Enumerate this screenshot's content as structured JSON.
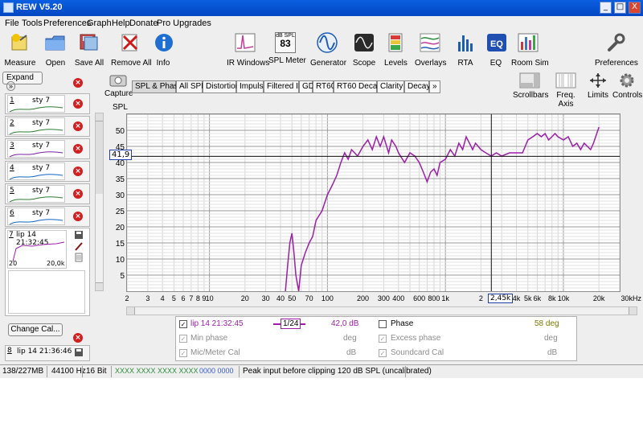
{
  "window": {
    "title": "REW V5.20"
  },
  "window_buttons": [
    "_",
    "□",
    "X"
  ],
  "menu": [
    "File",
    "Tools",
    "Preferences",
    "Graph",
    "Help",
    "Donate",
    "Pro Upgrades"
  ],
  "toolbar": {
    "measure": "Measure",
    "open": "Open",
    "save_all": "Save All",
    "remove_all": "Remove All",
    "info": "Info",
    "ir_windows": "IR Windows",
    "spl_meter": "SPL Meter",
    "spl_meter_top": "dB SPL",
    "spl_meter_value": "83",
    "generator": "Generator",
    "scope": "Scope",
    "levels": "Levels",
    "overlays": "Overlays",
    "rta": "RTA",
    "eq": "EQ",
    "room_sim": "Room Sim",
    "preferences": "Preferences"
  },
  "left": {
    "expand": "Expand",
    "expand_icon": "»",
    "measurements": [
      {
        "num": "1",
        "name": "sty 7",
        "color": "#2e7d32"
      },
      {
        "num": "2",
        "name": "sty 7",
        "color": "#2e7d32"
      },
      {
        "num": "3",
        "name": "sty 7",
        "color": "#7b1fa2"
      },
      {
        "num": "4",
        "name": "sty 7",
        "color": "#1565c0"
      },
      {
        "num": "5",
        "name": "sty 7",
        "color": "#2e7d32"
      },
      {
        "num": "6",
        "name": "sty 7",
        "color": "#1565c0"
      }
    ],
    "selected": {
      "num": "7",
      "name": "lip 14 21:32:45",
      "range_lo": "20",
      "range_hi": "20,0k"
    },
    "next": {
      "num": "8",
      "name": "lip 14 21:36:46"
    },
    "change_cal": "Change Cal...",
    "close_icon": "×"
  },
  "capture": "Capture",
  "tabs": [
    "SPL & Phase",
    "All SPL",
    "Distortion",
    "Impulse",
    "Filtered IR",
    "GD",
    "RT60",
    "RT60 Decay",
    "Clarity",
    "Decay",
    "»"
  ],
  "right_tools": {
    "scrollbars": "Scrollbars",
    "freq_axis": "Freq. Axis",
    "limits": "Limits",
    "controls": "Controls"
  },
  "graph": {
    "ylabel": "SPL",
    "cursor_y": "41,9",
    "cursor_x": "2,45k",
    "xunit": "30kHz"
  },
  "chart_data": {
    "type": "line",
    "ylabel": "SPL",
    "xscale": "log",
    "xlim": [
      2,
      30000
    ],
    "ylim": [
      0,
      55
    ],
    "grid": true,
    "yticks": [
      5,
      10,
      15,
      20,
      25,
      30,
      35,
      40,
      45,
      50
    ],
    "xticks": [
      "2",
      "3",
      "4",
      "5",
      "6",
      "7",
      "8",
      "9",
      "10",
      "20",
      "30",
      "40",
      "50",
      "70",
      "100",
      "200",
      "300",
      "400",
      "600",
      "800",
      "1k",
      "2",
      "4k",
      "5k",
      "6k",
      "8k",
      "10k",
      "20k",
      "30kHz"
    ],
    "xtick_values": [
      2,
      3,
      4,
      5,
      6,
      7,
      8,
      9,
      10,
      20,
      30,
      40,
      50,
      70,
      100,
      200,
      300,
      400,
      600,
      800,
      1000,
      2000,
      4000,
      5000,
      6000,
      8000,
      10000,
      20000,
      30000
    ],
    "cursor": {
      "x": 2450,
      "y": 41.9
    },
    "series": [
      {
        "name": "lip 14 21:32:45",
        "color": "#9c1fa8",
        "x": [
          44,
          46,
          48,
          50,
          52,
          54,
          57,
          60,
          65,
          70,
          75,
          80,
          90,
          100,
          110,
          120,
          130,
          140,
          150,
          160,
          180,
          200,
          220,
          240,
          260,
          280,
          300,
          330,
          350,
          380,
          400,
          450,
          500,
          550,
          600,
          650,
          700,
          750,
          800,
          850,
          900,
          1000,
          1100,
          1200,
          1300,
          1400,
          1500,
          1600,
          1700,
          1800,
          2000,
          2200,
          2450,
          2700,
          3000,
          3500,
          4000,
          4500,
          5000,
          5500,
          6000,
          6500,
          7000,
          7500,
          8000,
          8500,
          9000,
          10000,
          11000,
          12000,
          13000,
          14000,
          15000,
          16000,
          17000,
          18000,
          20000
        ],
        "y": [
          0,
          8,
          15,
          18,
          12,
          5,
          0,
          8,
          12,
          15,
          17,
          22,
          25,
          30,
          33,
          36,
          40,
          43,
          41,
          44,
          42,
          45,
          47,
          44,
          48,
          45,
          48,
          43,
          47,
          45,
          43,
          40,
          43,
          42,
          40,
          37,
          34,
          37,
          38,
          36,
          40,
          41,
          44,
          42,
          46,
          44,
          48,
          46,
          44,
          46,
          44,
          43,
          42,
          43,
          42,
          43,
          43,
          43,
          47,
          48,
          49,
          48,
          49,
          47,
          48,
          49,
          48,
          47,
          48,
          45,
          46,
          44,
          46,
          45,
          44,
          46,
          51
        ]
      }
    ]
  },
  "info": {
    "row1": {
      "name": "lip 14 21:32:45",
      "smoothing": "1/24",
      "value": "42,0 dB",
      "phase_label": "Phase",
      "phase_value": "58 deg"
    },
    "row2": {
      "label": "Min phase",
      "unit": "deg",
      "label2": "Excess phase",
      "unit2": "deg"
    },
    "row3": {
      "label": "Mic/Meter Cal",
      "unit": "dB",
      "label2": "Soundcard Cal",
      "unit2": "dB"
    }
  },
  "status": {
    "memory": "138/227MB",
    "rate": "44100 Hz",
    "bits": "16 Bit",
    "meter_a": "XXXX XXXX  XXXX XXXX",
    "meter_b": "0000 0000",
    "message": "Peak input before clipping 120 dB SPL (uncalibrated)"
  }
}
